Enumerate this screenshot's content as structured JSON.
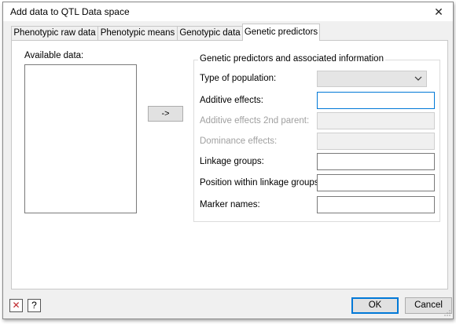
{
  "window": {
    "title": "Add data to QTL Data space",
    "close_glyph": "✕"
  },
  "tabs": [
    {
      "label": "Phenotypic raw data",
      "active": false
    },
    {
      "label": "Phenotypic means",
      "active": false
    },
    {
      "label": "Genotypic data",
      "active": false
    },
    {
      "label": "Genetic predictors",
      "active": true
    }
  ],
  "left": {
    "available_label": "Available data:",
    "move_button": "->"
  },
  "group": {
    "title": "Genetic predictors and associated information",
    "type_of_population_label": "Type of population:",
    "type_of_population_value": "",
    "additive_effects_label": "Additive effects:",
    "additive_effects_value": "",
    "additive_2nd_parent_label": "Additive effects 2nd parent:",
    "additive_2nd_parent_value": "",
    "dominance_effects_label": "Dominance effects:",
    "dominance_effects_value": "",
    "linkage_groups_label": "Linkage groups:",
    "linkage_groups_value": "",
    "position_label": "Position within linkage groups:",
    "position_value": "",
    "marker_names_label": "Marker names:",
    "marker_names_value": ""
  },
  "footer": {
    "clear_glyph": "✕",
    "help_glyph": "?",
    "ok_label": "OK",
    "cancel_label": "Cancel"
  },
  "colors": {
    "clear_icon": "#c0282d",
    "focus": "#0078d7"
  },
  "icons": [
    "close-icon",
    "chevron-down-icon",
    "clear-icon",
    "help-icon",
    "resize-grip-icon"
  ]
}
